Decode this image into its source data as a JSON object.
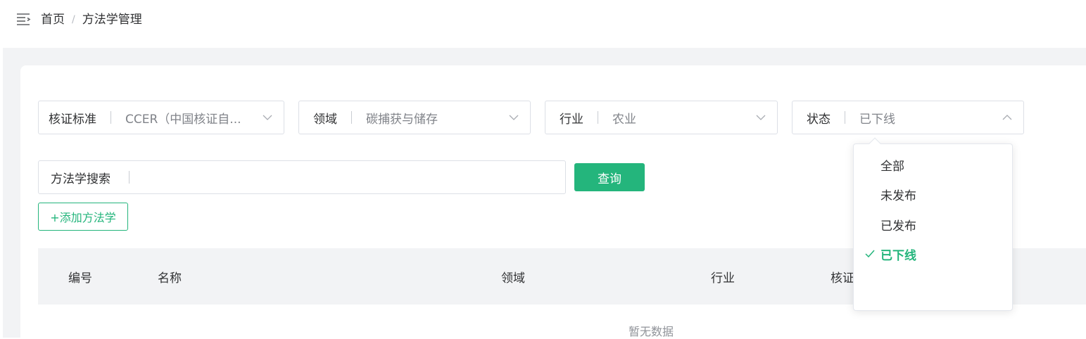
{
  "breadcrumb": {
    "home": "首页",
    "separator": "/",
    "current": "方法学管理"
  },
  "filters": {
    "standard": {
      "label": "核证标准",
      "value": "CCER（中国核证自..."
    },
    "domain": {
      "label": "领域",
      "value": "碳捕获与储存"
    },
    "industry": {
      "label": "行业",
      "value": "农业"
    },
    "status": {
      "label": "状态",
      "value": "已下线"
    }
  },
  "search": {
    "label": "方法学搜索",
    "value": ""
  },
  "buttons": {
    "query": "查询",
    "add": "+添加方法学"
  },
  "table": {
    "columns": [
      "编号",
      "名称",
      "领域",
      "行业",
      "核证"
    ],
    "empty_text": "暂无数据"
  },
  "status_dropdown": {
    "options": [
      "全部",
      "未发布",
      "已发布",
      "已下线"
    ],
    "selected": "已下线"
  },
  "colors": {
    "accent": "#24b57c",
    "background": "#f2f3f5"
  },
  "icons": {
    "menu": "menu-fold-icon",
    "chevron": "chevron-down-icon",
    "check": "check-icon"
  }
}
